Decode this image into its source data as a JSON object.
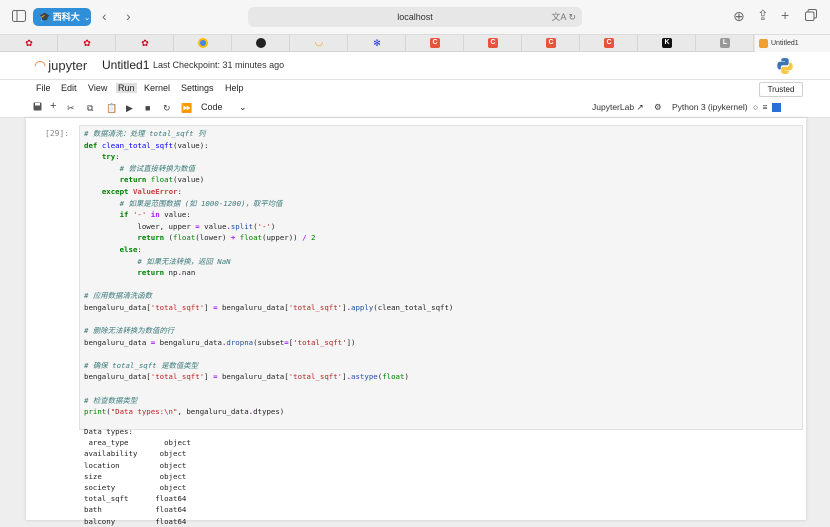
{
  "browser": {
    "profile_label": "西科大",
    "url": "localhost",
    "active_tab_title": "Untitled1",
    "tab_favicons": [
      "huawei-icon",
      "huawei-icon",
      "huawei-icon",
      "chrome-icon",
      "github-icon",
      "arc-icon",
      "baidu-icon",
      "c-icon",
      "c-icon",
      "c-icon",
      "c-icon",
      "k-icon",
      "l-icon"
    ]
  },
  "jupyter": {
    "logo_text": "jupyter",
    "notebook_title": "Untitled1",
    "checkpoint": "Last Checkpoint: 31 minutes ago",
    "menu": [
      "File",
      "Edit",
      "View",
      "Run",
      "Kernel",
      "Settings",
      "Help"
    ],
    "active_menu": "Run",
    "trusted": "Trusted",
    "cell_type": "Code",
    "jupyterlab_link": "JupyterLab",
    "kernel": "Python 3 (ipykernel)"
  },
  "cell": {
    "prompt": "[29]:",
    "code_lines": [
      "# 数据清洗：处理 total_sqft 列",
      "def clean_total_sqft(value):",
      "    try:",
      "        # 尝试直接转换为数值",
      "        return float(value)",
      "    except ValueError:",
      "        # 如果是范围数据 (如 1000-1200), 取平均值",
      "        if '-' in value:",
      "            lower, upper = value.split('-')",
      "            return (float(lower) + float(upper)) / 2",
      "        else:",
      "            # 如果无法转换, 返回 NaN",
      "            return np.nan",
      "",
      "# 应用数据清洗函数",
      "bengaluru_data['total_sqft'] = bengaluru_data['total_sqft'].apply(clean_total_sqft)",
      "",
      "# 删除无法转换为数值的行",
      "bengaluru_data = bengaluru_data.dropna(subset=['total_sqft'])",
      "",
      "# 确保 total_sqft 是数值类型",
      "bengaluru_data['total_sqft'] = bengaluru_data['total_sqft'].astype(float)",
      "",
      "# 检查数据类型",
      "print(\"Data types:\\n\", bengaluru_data.dtypes)"
    ],
    "output_lines": [
      "Data types:",
      " area_type        object",
      "availability     object",
      "location         object",
      "size             object",
      "society          object",
      "total_sqft      float64",
      "bath            float64",
      "balcony         float64"
    ]
  }
}
